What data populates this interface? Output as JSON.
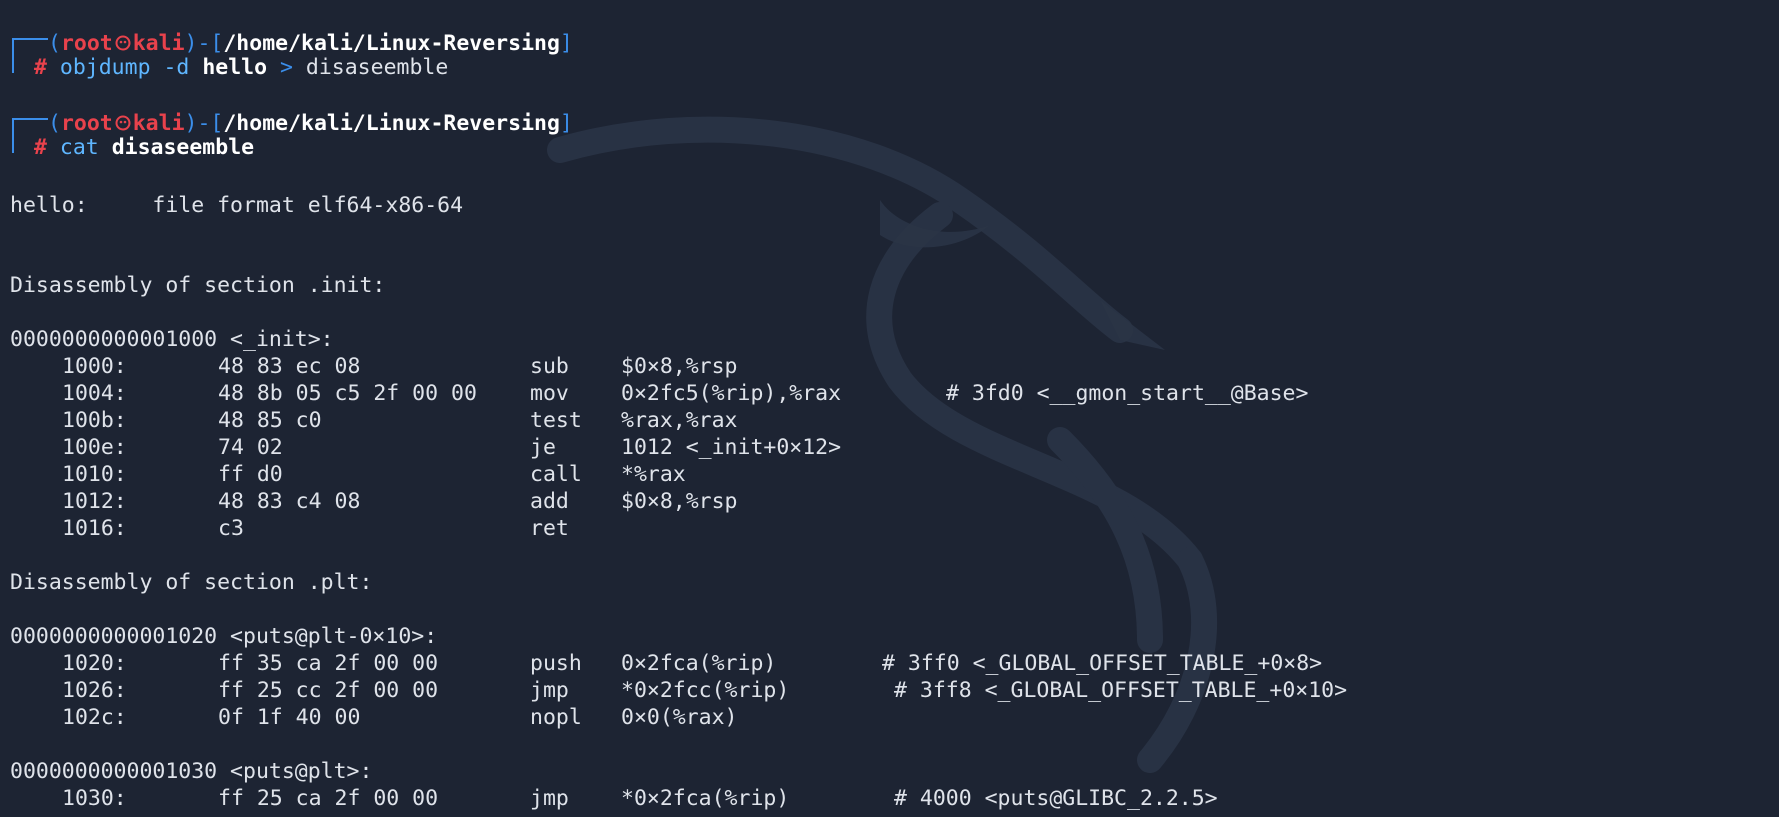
{
  "prompt1": {
    "user": "root",
    "host": "kali",
    "path": "/home/kali/Linux-Reversing",
    "symbol": "#",
    "command": "objdump",
    "args": "-d",
    "target": "hello",
    "redirect": ">",
    "outfile": "disaseemble"
  },
  "prompt2": {
    "user": "root",
    "host": "kali",
    "path": "/home/kali/Linux-Reversing",
    "symbol": "#",
    "command": "cat",
    "target": "disaseemble"
  },
  "file_format_line": "hello:     file format elf64-x86-64",
  "section_init": "Disassembly of section .init:",
  "init_label": "0000000000001000 <_init>:",
  "init_rows": [
    {
      "addr": "1000:",
      "bytes": "48 83 ec 08",
      "op": "sub",
      "args": "$0×8,%rsp",
      "comment": ""
    },
    {
      "addr": "1004:",
      "bytes": "48 8b 05 c5 2f 00 00",
      "op": "mov",
      "args": "0×2fc5(%rip),%rax",
      "comment": "# 3fd0 <__gmon_start__@Base>"
    },
    {
      "addr": "100b:",
      "bytes": "48 85 c0",
      "op": "test",
      "args": "%rax,%rax",
      "comment": ""
    },
    {
      "addr": "100e:",
      "bytes": "74 02",
      "op": "je",
      "args": "1012 <_init+0×12>",
      "comment": ""
    },
    {
      "addr": "1010:",
      "bytes": "ff d0",
      "op": "call",
      "args": "*%rax",
      "comment": ""
    },
    {
      "addr": "1012:",
      "bytes": "48 83 c4 08",
      "op": "add",
      "args": "$0×8,%rsp",
      "comment": ""
    },
    {
      "addr": "1016:",
      "bytes": "c3",
      "op": "ret",
      "args": "",
      "comment": ""
    }
  ],
  "section_plt": "Disassembly of section .plt:",
  "plt_label": "0000000000001020 <puts@plt-0×10>:",
  "plt_rows": [
    {
      "addr": "1020:",
      "bytes": "ff 35 ca 2f 00 00",
      "op": "push",
      "args": "0×2fca(%rip)",
      "comment": "# 3ff0 <_GLOBAL_OFFSET_TABLE_+0×8>"
    },
    {
      "addr": "1026:",
      "bytes": "ff 25 cc 2f 00 00",
      "op": "jmp",
      "args": "*0×2fcc(%rip)",
      "comment": "# 3ff8 <_GLOBAL_OFFSET_TABLE_+0×10>"
    },
    {
      "addr": "102c:",
      "bytes": "0f 1f 40 00",
      "op": "nopl",
      "args": "0×0(%rax)",
      "comment": ""
    }
  ],
  "puts_label": "0000000000001030 <puts@plt>:",
  "puts_rows": [
    {
      "addr": "1030:",
      "bytes": "ff 25 ca 2f 00 00",
      "op": "jmp",
      "args": "*0×2fca(%rip)",
      "comment": "# 4000 <puts@GLIBC_2.2.5>"
    }
  ],
  "colors": {
    "background": "#1d2433",
    "prompt_red": "#e8424c",
    "prompt_blue": "#3b8eea",
    "text": "#dfe3ea"
  }
}
